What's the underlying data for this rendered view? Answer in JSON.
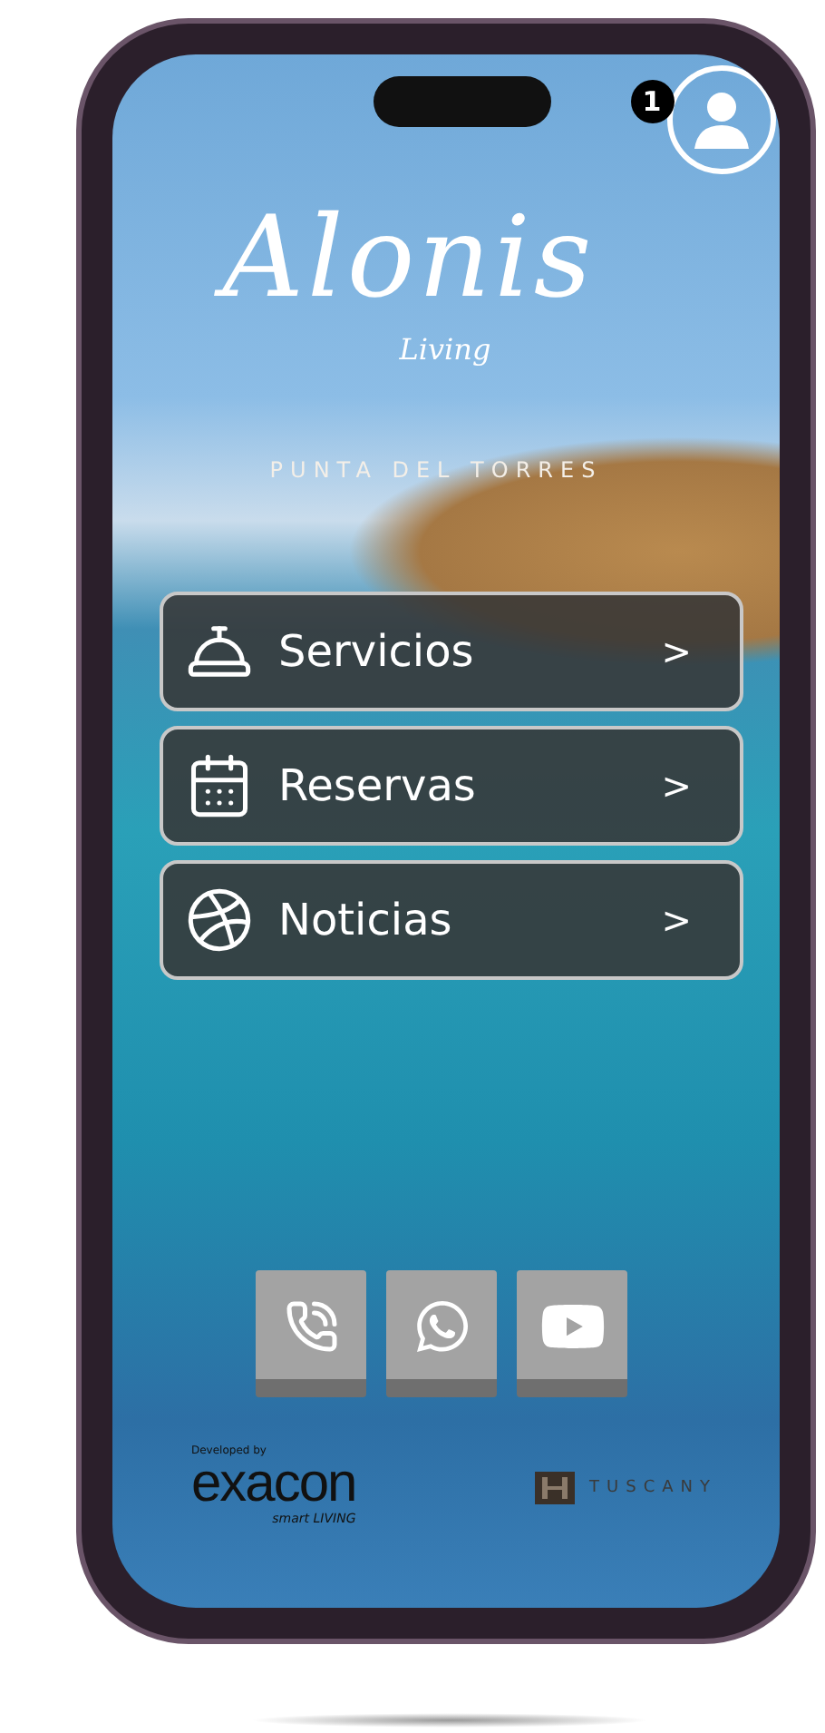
{
  "header": {
    "notification_count": "1"
  },
  "logo": {
    "name": "Alonis",
    "tagline": "Living",
    "location": "PUNTA DEL TORRES"
  },
  "menu": [
    {
      "kind": "services",
      "label": "Servicios",
      "arrow": ">"
    },
    {
      "kind": "bookings",
      "label": "Reservas",
      "arrow": ">"
    },
    {
      "kind": "news",
      "label": "Noticias",
      "arrow": ">"
    }
  ],
  "contacts": [
    {
      "kind": "phone"
    },
    {
      "kind": "whatsapp"
    },
    {
      "kind": "video"
    }
  ],
  "footer": {
    "developer_caption": "Developed by",
    "developer": "exacon",
    "developer_tagline": "smart LIVING",
    "partner": "TUSCANY"
  }
}
